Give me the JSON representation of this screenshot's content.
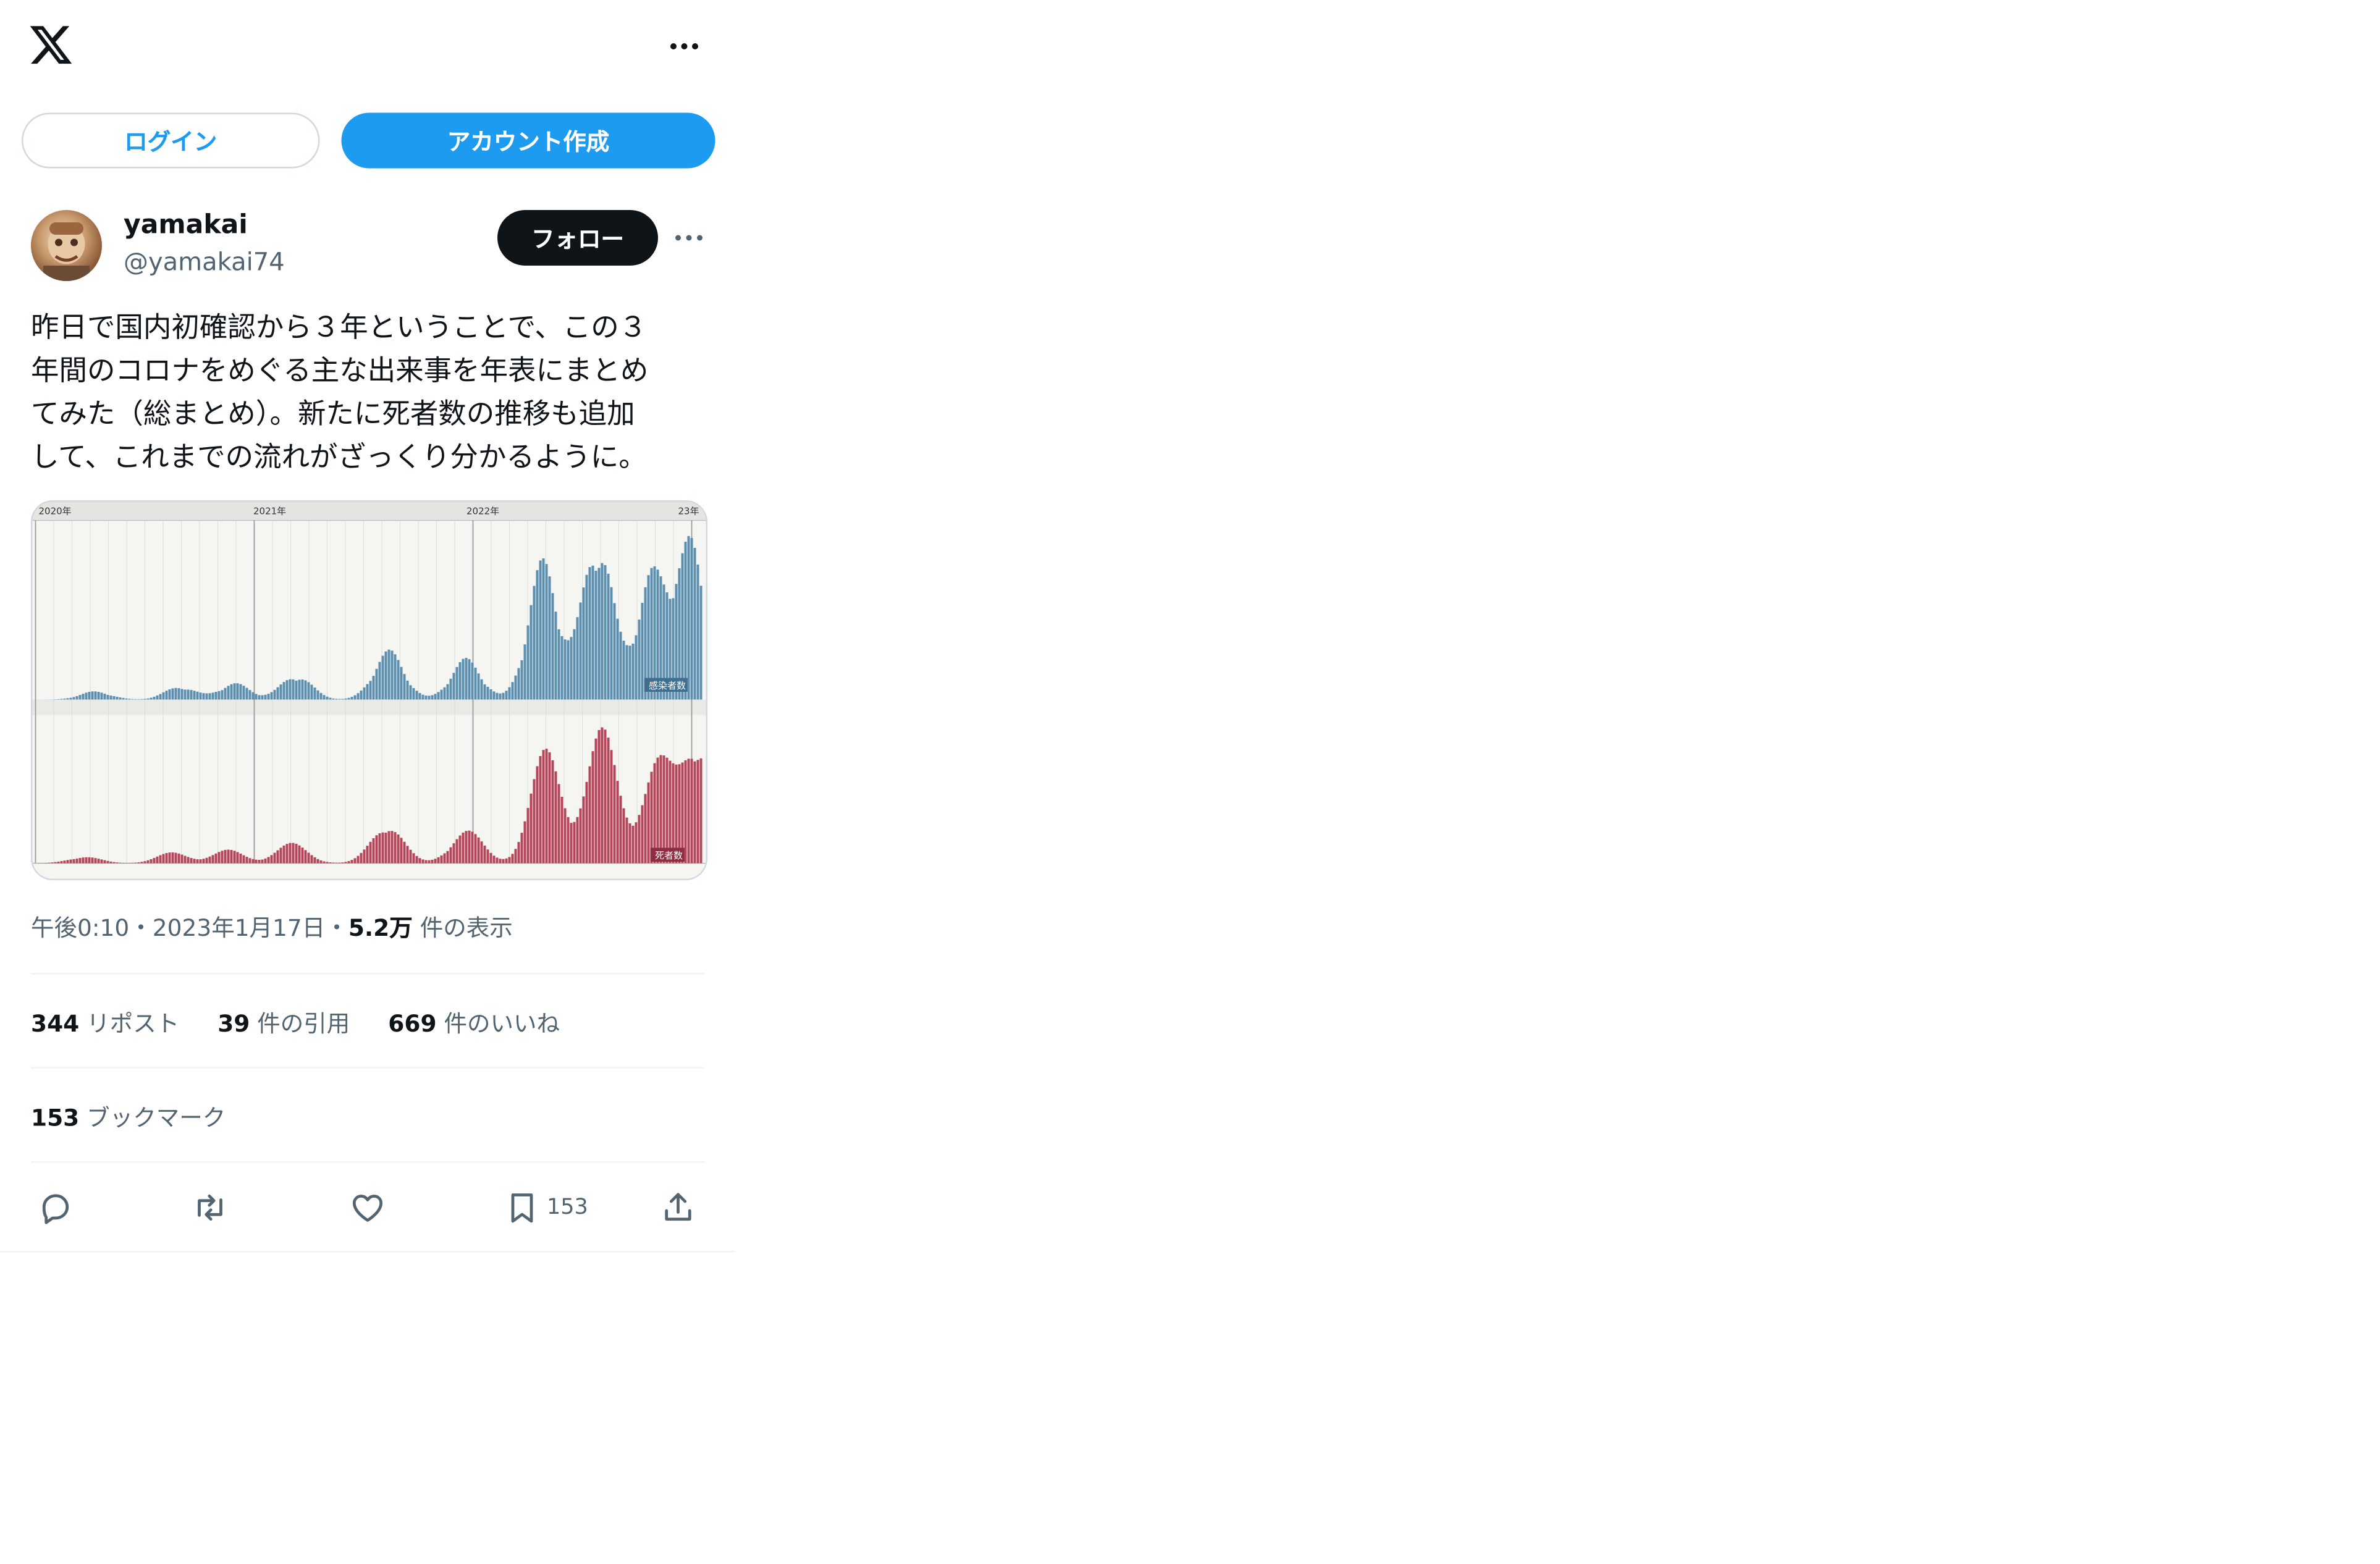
{
  "header": {
    "logo_icon": "x-logo-icon",
    "more_icon": "more-horizontal-icon"
  },
  "auth": {
    "login_label": "ログイン",
    "signup_label": "アカウント作成"
  },
  "author": {
    "display_name": "yamakai",
    "handle": "@yamakai74",
    "follow_label": "フォロー"
  },
  "tweet": {
    "text": "昨日で国内初確認から３年ということで、この３\n年間のコロナをめぐる主な出来事を年表にまとめ\nてみた（総まとめ）。新たに死者数の推移も追加\nして、これまでの流れがざっくり分かるように。",
    "time": "午後0:10",
    "sep1": "・",
    "date": "2023年1月17日",
    "sep2": "・",
    "views_count": "5.2万",
    "views_label": " 件の表示"
  },
  "stats": {
    "reposts_count": "344",
    "reposts_label": " リポスト",
    "quotes_count": "39",
    "quotes_label": " 件の引用",
    "likes_count": "669",
    "likes_label": " 件のいいね",
    "bookmarks_count": "153",
    "bookmarks_label": " ブックマーク"
  },
  "actions": {
    "bookmark_count": "153"
  },
  "media": {
    "year_labels": [
      "2020年",
      "2021年",
      "2022年",
      "23年"
    ],
    "cases_label": "感染者数",
    "deaths_label": "死者数",
    "case_color": "#5b8fb0",
    "death_color": "#b5465a"
  }
}
